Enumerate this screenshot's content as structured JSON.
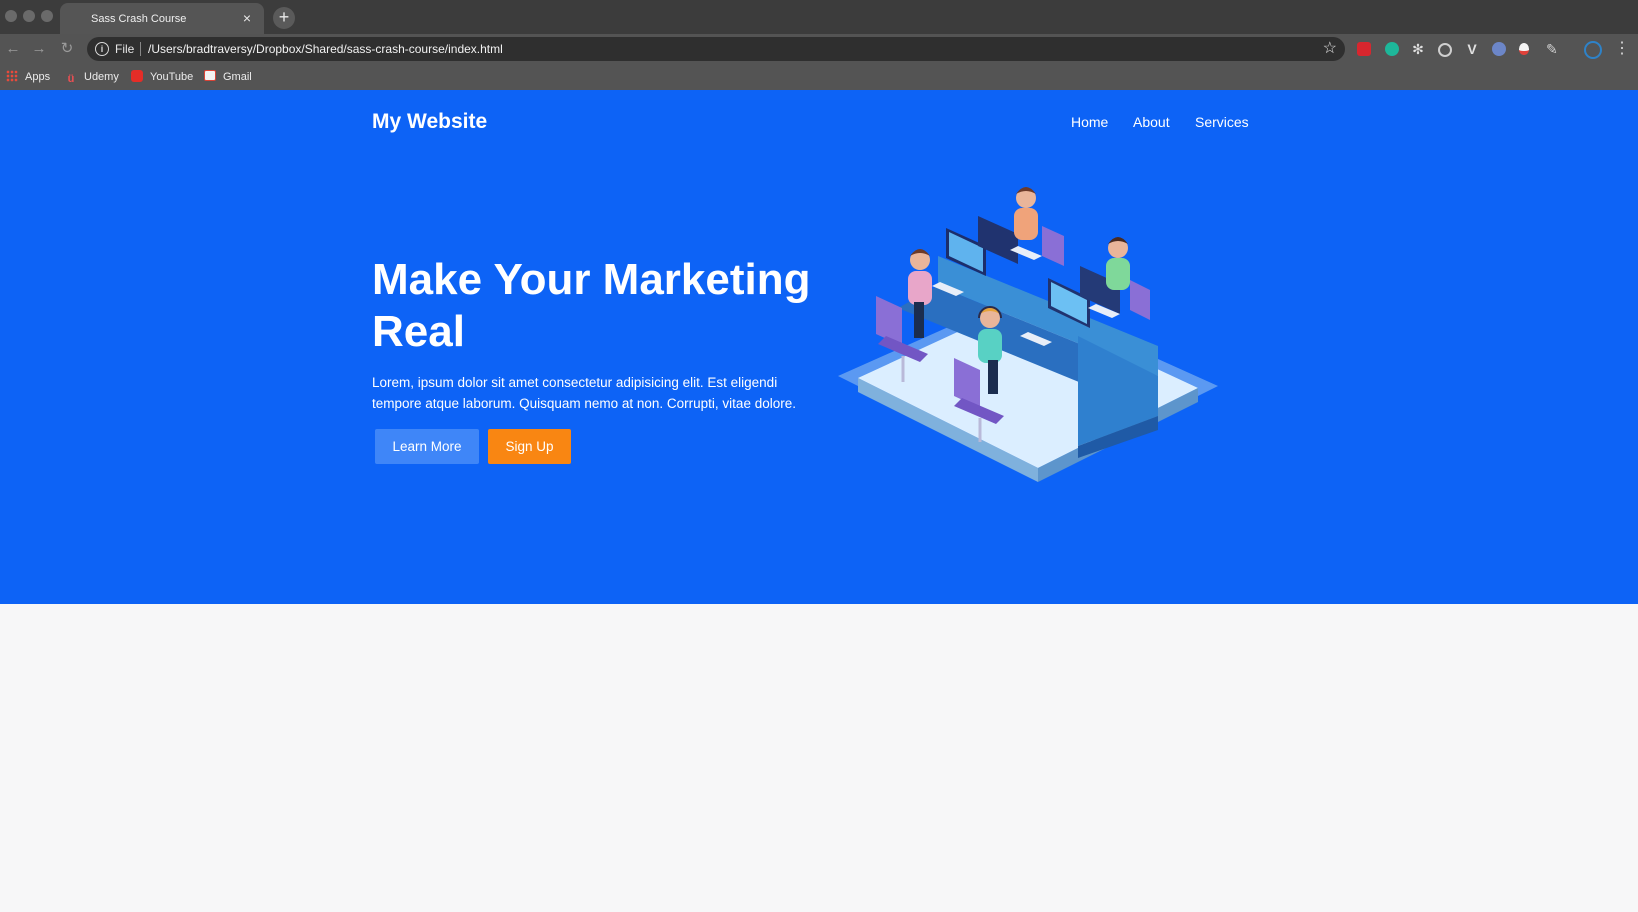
{
  "browser": {
    "tab_title": "Sass Crash Course",
    "tab_close": "×",
    "new_tab": "+",
    "address_prefix": "File",
    "url": "/Users/bradtraversy/Dropbox/Shared/sass-crash-course/index.html",
    "bookmarks": [
      {
        "label": "Apps",
        "icon": "apps-grid-icon"
      },
      {
        "label": "Udemy",
        "icon": "udemy-icon"
      },
      {
        "label": "YouTube",
        "icon": "youtube-icon"
      },
      {
        "label": "Gmail",
        "icon": "gmail-icon"
      }
    ]
  },
  "page": {
    "brand": "My Website",
    "nav": [
      "Home",
      "About",
      "Services"
    ],
    "hero": {
      "headline": "Make Your Marketing Real",
      "lead": "Lorem, ipsum dolor sit amet consectetur adipisicing elit. Est eligendi tempore atque laborum. Quisquam nemo at non. Corrupti, vitae dolore.",
      "learn_more": "Learn More",
      "sign_up": "Sign Up"
    }
  },
  "colors": {
    "hero_bg": "#0d63f6",
    "primary_button": "#3f86f8",
    "accent_button": "#f98612",
    "page_bg": "#f7f7f8"
  }
}
